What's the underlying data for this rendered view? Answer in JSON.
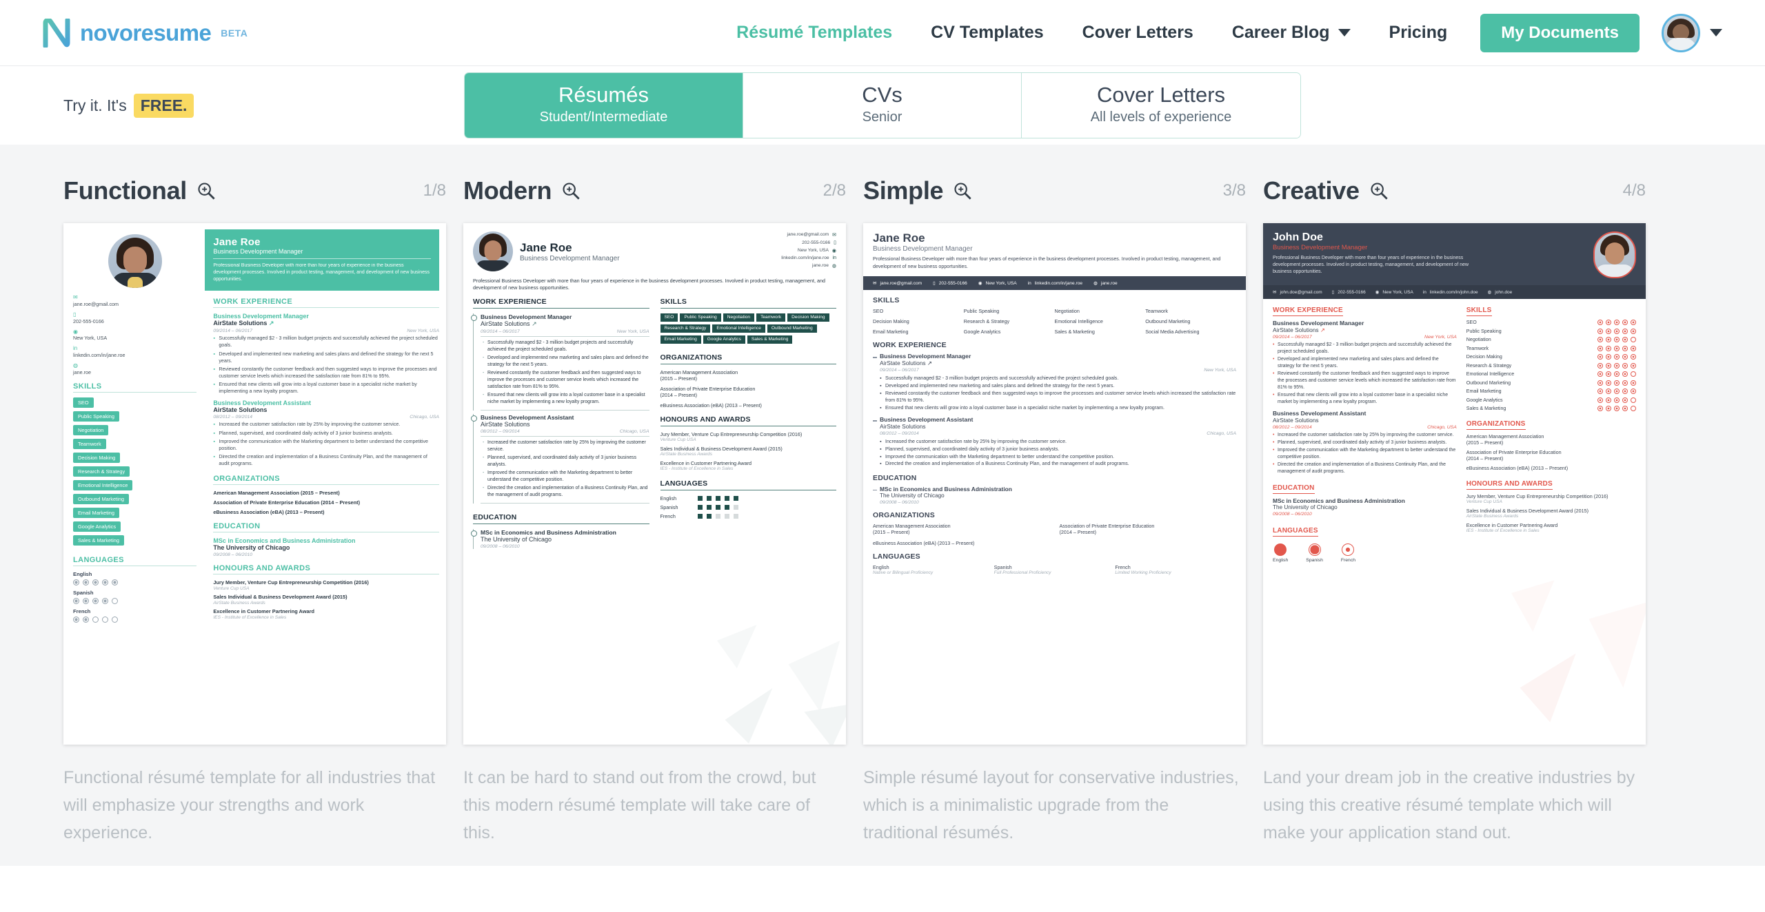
{
  "brand": {
    "name": "novoresume",
    "beta": "BETA",
    "logo_icon": "novoresume-n-logo",
    "accent": "#4cbfa5",
    "logo_color": "#4aa3d8"
  },
  "nav": {
    "items": [
      {
        "label": "Résumé Templates",
        "active": true,
        "caret": false
      },
      {
        "label": "CV Templates",
        "active": false,
        "caret": false
      },
      {
        "label": "Cover Letters",
        "active": false,
        "caret": false
      },
      {
        "label": "Career Blog",
        "active": false,
        "caret": true
      },
      {
        "label": "Pricing",
        "active": false,
        "caret": false
      }
    ],
    "cta": "My Documents",
    "avatar_icon": "user-avatar",
    "avatar_caret_icon": "chevron-down-icon"
  },
  "subheader": {
    "free_text": "Try it. It's",
    "free_badge": "FREE.",
    "free_badge_color": "#fada62",
    "tabs": [
      {
        "title": "Résumés",
        "sub": "Student/Intermediate",
        "active": true
      },
      {
        "title": "CVs",
        "sub": "Senior",
        "active": false
      },
      {
        "title": "Cover Letters",
        "sub": "All levels of experience",
        "active": false
      }
    ]
  },
  "gallery": {
    "cards": [
      {
        "title": "Functional",
        "count": "1/8",
        "zoom_icon": "zoom-in-icon",
        "description": "Functional résumé template for all industries that will emphasize your strengths and work experience."
      },
      {
        "title": "Modern",
        "count": "2/8",
        "zoom_icon": "zoom-in-icon",
        "description": "It can be hard to stand out from the crowd, but this modern résumé template will take care of this."
      },
      {
        "title": "Simple",
        "count": "3/8",
        "zoom_icon": "zoom-in-icon",
        "description": "Simple résumé layout for conservative industries, which is a minimalistic upgrade from the traditional résumés."
      },
      {
        "title": "Creative",
        "count": "4/8",
        "zoom_icon": "zoom-in-icon",
        "description": "Land your dream job in the creative industries by using this creative résumé template which will make your application stand out."
      }
    ]
  },
  "resume": {
    "name_jane": "Jane Roe",
    "name_john": "John Doe",
    "role": "Business Development Manager",
    "summary": "Professional Business Developer with more than four years of experience in the business development processes. Involved in product testing, management, and development of new business opportunities.",
    "contact": {
      "email": "jane.roe@gmail.com",
      "phone": "202-555-0166",
      "location": "New York, USA",
      "linkedin": "linkedin.com/in/jane.roe",
      "skype": "jane.roe",
      "email_john": "john.doe@gmail.com",
      "linkedin_john": "linkedin.com/in/john.doe",
      "skype_john": "john.doe"
    },
    "headings": {
      "work": "WORK EXPERIENCE",
      "skills": "SKILLS",
      "organizations": "ORGANIZATIONS",
      "education": "EDUCATION",
      "honours": "HONOURS AND AWARDS",
      "languages": "LANGUAGES"
    },
    "jobs": [
      {
        "title": "Business Development Manager",
        "company": "AirState Solutions",
        "dates": "09/2014 – 06/2017",
        "place": "New York, USA",
        "bullets": [
          "Successfully managed $2 - 3 million budget projects and successfully achieved the project scheduled goals.",
          "Developed and implemented new marketing and sales plans and defined the strategy for the next 5 years.",
          "Reviewed constantly the customer feedback and then suggested ways to improve the processes and customer service levels which increased the satisfaction rate from 81% to 95%.",
          "Ensured that new clients will grow into a loyal customer base in a specialist niche market by implementing a new loyalty program."
        ]
      },
      {
        "title": "Business Development Assistant",
        "company": "AirState Solutions",
        "dates": "08/2012 – 09/2014",
        "place": "Chicago, USA",
        "bullets": [
          "Increased the customer satisfaction rate by 25% by improving the customer service.",
          "Planned, supervised, and coordinated daily activity of 3 junior business analysts.",
          "Improved the communication with the Marketing department to better understand the competitive position.",
          "Directed the creation and implementation of a Business Continuity Plan, and the management of audit programs."
        ]
      }
    ],
    "skills": [
      "SEO",
      "Public Speaking",
      "Negotiation",
      "Teamwork",
      "Decision Making",
      "Research & Strategy",
      "Emotional Intelligence",
      "Outbound Marketing",
      "Email Marketing",
      "Google Analytics",
      "Sales & Marketing"
    ],
    "skills_simple_extra": "Social Media Advertising",
    "skill_levels": [
      5,
      5,
      4,
      5,
      5,
      5,
      4,
      5,
      5,
      4,
      4
    ],
    "organizations": [
      "American Management Association (2015 – Present)",
      "Association of Private Enterprise Education (2014 – Present)",
      "eBusiness Association (eBA) (2013 – Present)"
    ],
    "organizations_split": [
      {
        "l1": "American Management Association",
        "l2": "(2015 – Present)"
      },
      {
        "l1": "Association of Private Enterprise Education",
        "l2": "(2014 – Present)"
      },
      {
        "l1": "eBusiness Association (eBA) (2013 – Present)",
        "l2": ""
      }
    ],
    "education": {
      "degree": "MSc in Economics and Business Administration",
      "school": "The University of Chicago",
      "dates": "09/2008 – 06/2010"
    },
    "honours": [
      {
        "title": "Jury Member, Venture Cup Entrepreneurship Competition (2016)",
        "org": "Venture Cup USA"
      },
      {
        "title": "Sales Individual & Business Development Award (2015)",
        "org": "AirState Business Awards"
      },
      {
        "title": "Excellence in Customer Partnering Award",
        "org": "IES - Institute of Excellence in Sales"
      }
    ],
    "languages": [
      {
        "name": "English",
        "level": 5,
        "proficiency": "Native or Bilingual Proficiency"
      },
      {
        "name": "Spanish",
        "level": 4,
        "proficiency": "Full Professional Proficiency"
      },
      {
        "name": "French",
        "level": 2,
        "proficiency": "Limited Working Proficiency"
      }
    ],
    "colors": {
      "functional": "#4cbfa5",
      "modern": "#1f4f4a",
      "simple": "#3d4655",
      "creative": "#e2574c"
    }
  }
}
